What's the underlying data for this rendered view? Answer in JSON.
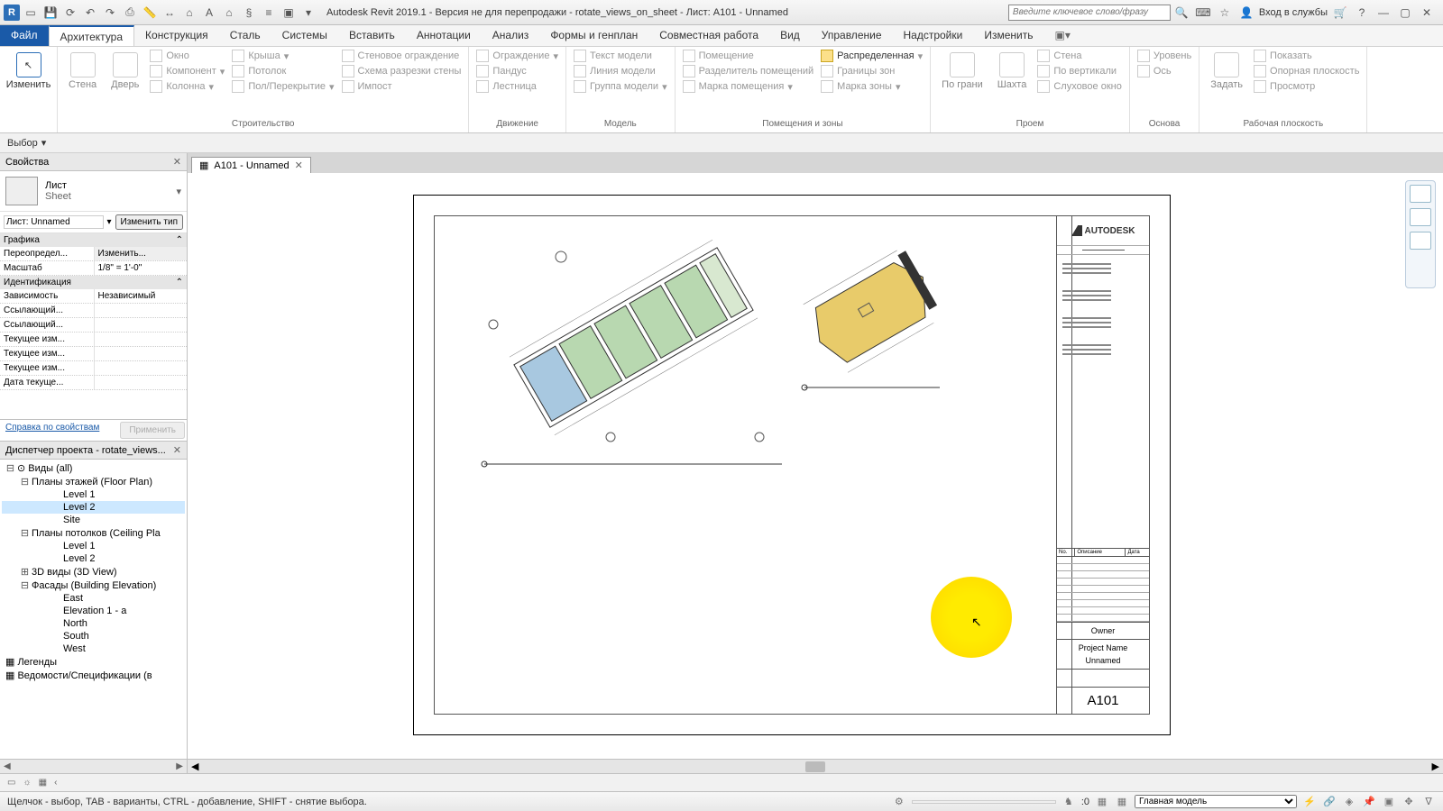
{
  "qat": {
    "title": "Autodesk Revit 2019.1 - Версия не для перепродажи - rotate_views_on_sheet - Лист: A101 - Unnamed",
    "search_placeholder": "Введите ключевое слово/фразу",
    "login": "Вход в службы"
  },
  "tabs": {
    "file": "Файл",
    "items": [
      "Архитектура",
      "Конструкция",
      "Сталь",
      "Системы",
      "Вставить",
      "Аннотации",
      "Анализ",
      "Формы и генплан",
      "Совместная работа",
      "Вид",
      "Управление",
      "Надстройки",
      "Изменить"
    ],
    "active": "Архитектура"
  },
  "selector": {
    "label": "Выбор",
    "dd": "▾"
  },
  "ribbon": {
    "modify": "Изменить",
    "build": {
      "label": "Строительство",
      "wall": "Стена",
      "door": "Дверь",
      "items": [
        "Окно",
        "Компонент",
        "Колонна",
        "Крыша",
        "Потолок",
        "Пол/Перекрытие",
        "Стеновое ограждение",
        "Схема разрезки стены",
        "Импост",
        "Ограждение",
        "Пандус",
        "Лестница"
      ]
    },
    "circulation": {
      "label": "Движение"
    },
    "model": {
      "label": "Модель",
      "items": [
        "Текст модели",
        "Линия модели",
        "Группа модели"
      ]
    },
    "rooms": {
      "label": "Помещения и зоны",
      "items": [
        "Помещение",
        "Разделитель помещений",
        "Марка помещения",
        "Распределенная",
        "Границы зон",
        "Марка зоны"
      ]
    },
    "opening": {
      "label": "Проем",
      "by": "По грани",
      "shaft": "Шахта",
      "items": [
        "Стена",
        "По вертикали",
        "Слуховое окно"
      ]
    },
    "datum": {
      "label": "Основа",
      "set": "Задать",
      "items": [
        "Уровень",
        "Ось"
      ]
    },
    "workplane": {
      "label": "Рабочая плоскость",
      "items": [
        "Показать",
        "Опорная плоскость",
        "Просмотр"
      ]
    }
  },
  "props": {
    "title": "Свойства",
    "type_cat": "Лист",
    "type_name": "Sheet",
    "instance": "Лист: Unnamed",
    "edit_type": "Изменить тип",
    "help": "Справка по свойствам",
    "apply": "Применить",
    "cats": {
      "graphics": "Графика",
      "identity": "Идентификация"
    },
    "rows": [
      {
        "k": "Переопредел...",
        "v": "Изменить..."
      },
      {
        "k": "Масштаб",
        "v": "1/8\" = 1'-0\""
      },
      {
        "k": "Зависимость",
        "v": "Независимый"
      },
      {
        "k": "Ссылающий...",
        "v": ""
      },
      {
        "k": "Ссылающий...",
        "v": ""
      },
      {
        "k": "Текущее изм...",
        "v": ""
      },
      {
        "k": "Текущее изм...",
        "v": ""
      },
      {
        "k": "Текущее изм...",
        "v": ""
      },
      {
        "k": "Дата текуще...",
        "v": ""
      }
    ]
  },
  "browser": {
    "title": "Диспетчер проекта - rotate_views...",
    "root": "Виды (all)",
    "groups": [
      {
        "name": "Планы этажей (Floor Plan)",
        "items": [
          "Level 1",
          "Level 2",
          "Site"
        ],
        "sel": "Level 2"
      },
      {
        "name": "Планы потолков (Ceiling Pla",
        "items": [
          "Level 1",
          "Level 2"
        ]
      },
      {
        "name": "3D виды (3D View)",
        "items": []
      },
      {
        "name": "Фасады (Building Elevation)",
        "items": [
          "East",
          "Elevation 1 - a",
          "North",
          "South",
          "West"
        ]
      }
    ],
    "extra": [
      "Легенды",
      "Ведомости/Спецификации (в"
    ]
  },
  "doc_tab": {
    "label": "A101 - Unnamed"
  },
  "titleblock": {
    "brand": "AUTODESK",
    "owner": "Owner",
    "project": "Project Name",
    "pname": "Unnamed",
    "number": "A101",
    "rev_headers": [
      "No.",
      "Описание",
      "Дата"
    ]
  },
  "status": {
    "hint": "Щелчок - выбор, TAB - варианты, CTRL - добавление, SHIFT - снятие выбора.",
    "zero": ":0",
    "workset": "Главная модель"
  }
}
